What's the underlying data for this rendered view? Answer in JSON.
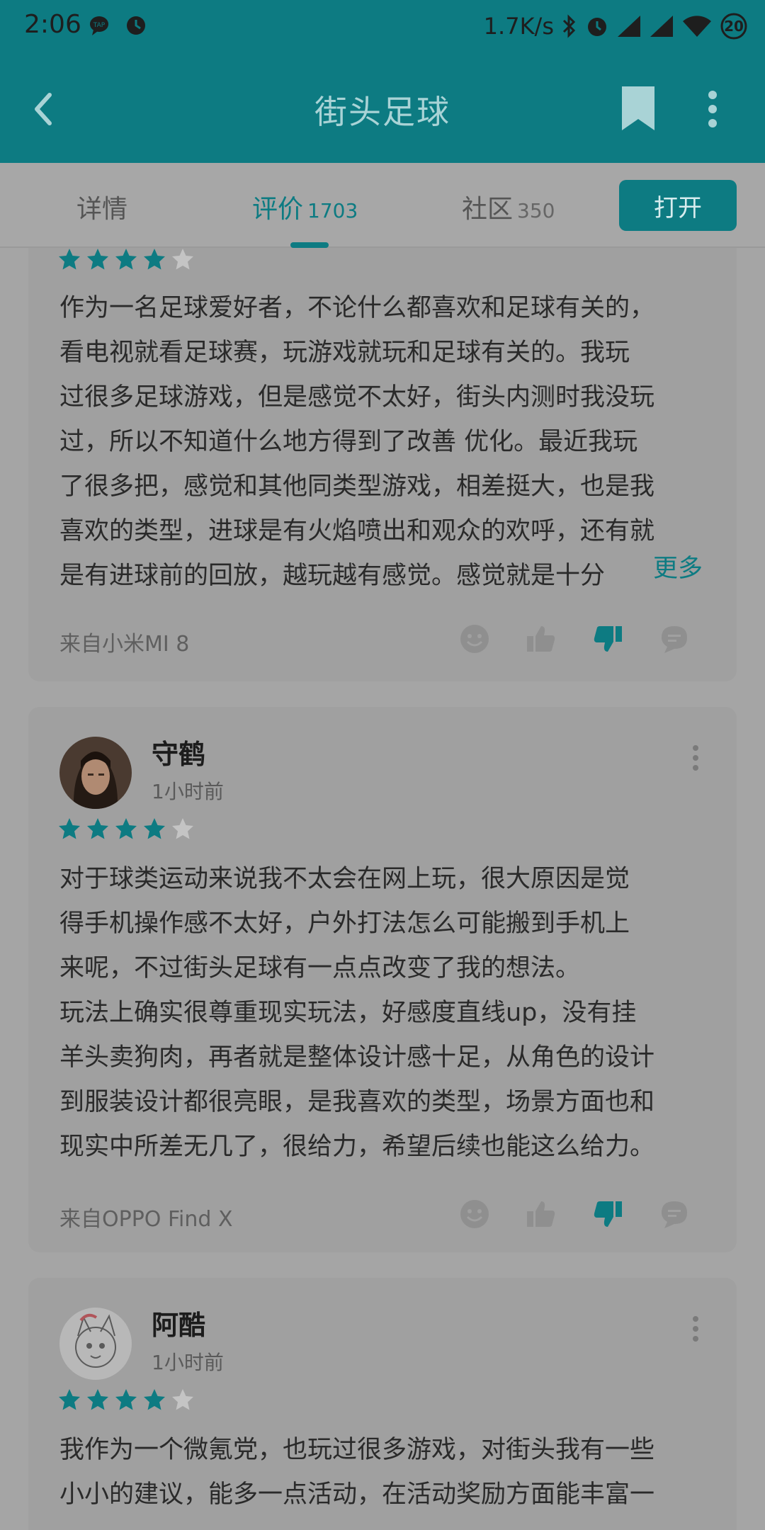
{
  "status_bar": {
    "time": "2:06",
    "network_speed": "1.7K/s",
    "battery_level": "20"
  },
  "app_bar": {
    "title": "街头足球"
  },
  "tabs": [
    {
      "label": "详情",
      "count": ""
    },
    {
      "label": "评价",
      "count": "1703"
    },
    {
      "label": "社区",
      "count": "350"
    }
  ],
  "active_tab": "评价",
  "open_button_label": "打开",
  "reviews": [
    {
      "username": "",
      "time": "",
      "stars": 4,
      "text": "作为一名足球爱好者，不论什么都喜欢和足球有关的，\n看电视就看足球赛，玩游戏就玩和足球有关的。我玩\n过很多足球游戏，但是感觉不太好，街头内测时我没玩\n过，所以不知道什么地方得到了改善 优化。最近我玩\n了很多把，感觉和其他同类型游戏，相差挺大，也是我\n喜欢的类型，进球是有火焰喷出和观众的欢呼，还有就\n是有进球前的回放，越玩越有感觉。感觉就是十分",
      "more_label": "更多",
      "device": "来自小米MI 8"
    },
    {
      "username": "守鹤",
      "time": "1小时前",
      "stars": 4,
      "text": "对于球类运动来说我不太会在网上玩，很大原因是觉\n得手机操作感不太好，户外打法怎么可能搬到手机上\n来呢，不过街头足球有一点点改变了我的想法。\n玩法上确实很尊重现实玩法，好感度直线up，没有挂\n羊头卖狗肉，再者就是整体设计感十足，从角色的设计\n到服装设计都很亮眼，是我喜欢的类型，场景方面也和\n现实中所差无几了，很给力，希望后续也能这么给力。",
      "device": "来自OPPO Find X"
    },
    {
      "username": "阿酷",
      "time": "1小时前",
      "stars": 4,
      "text": "我作为一个微氪党，也玩过很多游戏，对街头我有一些\n小小的建议，能多一点活动，在活动奖励方面能丰富一"
    }
  ],
  "colors": {
    "accent": "#0d7b82",
    "overlay_bg": "#a5a5a5",
    "star_empty": "#c4c4c4"
  }
}
